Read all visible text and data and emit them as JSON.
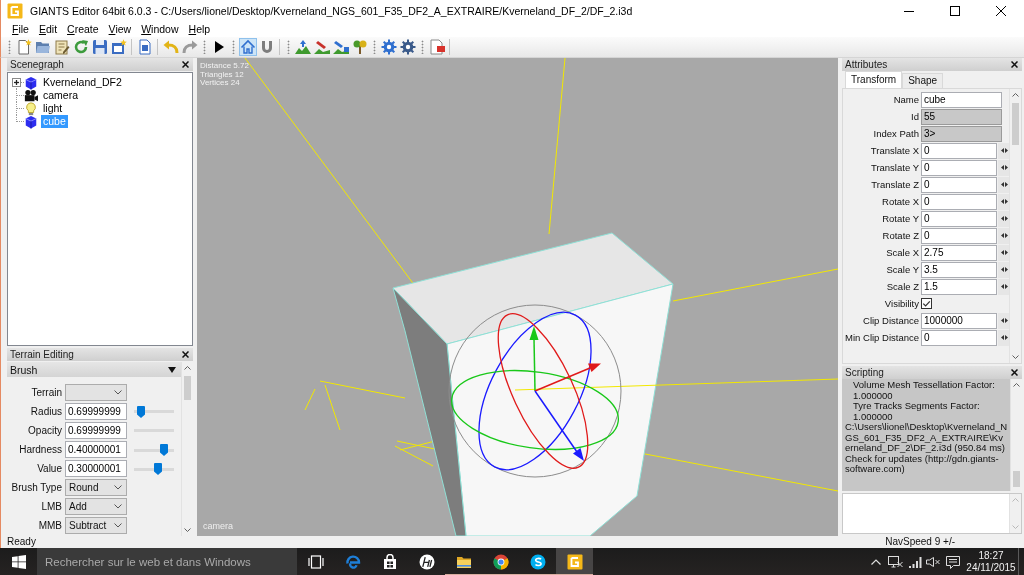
{
  "window": {
    "title": "GIANTS Editor 64bit 6.0.3 - C:/Users/lionel/Desktop/Kverneland_NGS_601_F35_DF2_A_EXTRAIRE/Kverneland_DF_2/DF_2.i3d"
  },
  "menu": [
    "File",
    "Edit",
    "Create",
    "View",
    "Window",
    "Help"
  ],
  "toolbar": [
    {
      "grip": true,
      "separator": false,
      "buttons": [
        {
          "selected": false
        },
        {
          "selected": false
        },
        {
          "selected": false
        },
        {
          "selected": false
        },
        {
          "selected": false
        },
        {
          "selected": false
        }
      ]
    },
    {
      "grip": false,
      "separator": true,
      "buttons": [
        {
          "selected": false
        }
      ]
    },
    {
      "grip": false,
      "separator": true,
      "buttons": [
        {
          "selected": false
        },
        {
          "selected": false
        }
      ]
    },
    {
      "grip": true,
      "separator": false,
      "buttons": [
        {
          "selected": false
        }
      ]
    },
    {
      "grip": true,
      "separator": false,
      "buttons": [
        {
          "selected": true
        },
        {
          "selected": false
        }
      ]
    },
    {
      "grip": true,
      "separator": true,
      "buttons": [
        {
          "selected": false
        },
        {
          "selected": false
        },
        {
          "selected": false
        },
        {
          "selected": false
        }
      ]
    },
    {
      "grip": true,
      "separator": false,
      "buttons": [
        {
          "selected": false
        },
        {
          "selected": false
        }
      ]
    },
    {
      "grip": true,
      "separator": false,
      "buttons": [
        {
          "selected": false
        }
      ]
    }
  ],
  "scenegraph": {
    "title": "Scenegraph",
    "nodes": [
      {
        "label": "Kverneland_DF2",
        "kind": "shape",
        "expandable": true,
        "expanded": false,
        "selected": false
      },
      {
        "label": "camera",
        "kind": "camera",
        "expandable": false,
        "selected": false
      },
      {
        "label": "light",
        "kind": "light",
        "expandable": false,
        "selected": false
      },
      {
        "label": "cube",
        "kind": "shape",
        "expandable": false,
        "selected": true
      }
    ]
  },
  "terrain_editing": {
    "title": "Terrain Editing",
    "section": "Brush",
    "section_expanded": true,
    "fields": [
      {
        "kind": "select",
        "label": "Terrain"
      },
      {
        "kind": "slider",
        "label": "Radius",
        "value": "0.69999999",
        "level": 0.08
      },
      {
        "kind": "track",
        "label": "Opacity",
        "value": "0.69999999"
      },
      {
        "kind": "slider",
        "label": "Hardness",
        "value": "0.40000001",
        "level": 0.82
      },
      {
        "kind": "slider",
        "label": "Value",
        "value": "0.30000001",
        "level": 0.62
      },
      {
        "kind": "select",
        "label": "Brush Type",
        "value": "Round"
      },
      {
        "kind": "select",
        "label": "LMB",
        "value": "Add"
      },
      {
        "kind": "select",
        "label": "MMB",
        "value": "Subtract"
      }
    ]
  },
  "viewport": {
    "stats": [
      "Distance 5.72",
      "Triangles 12",
      "Vertices 24"
    ],
    "camera": "camera"
  },
  "attributes": {
    "title": "Attributes",
    "tabs": [
      {
        "label": "Transform",
        "selected": true
      },
      {
        "label": "Shape",
        "selected": false
      }
    ],
    "fields": [
      {
        "kind": "text",
        "label": "Name",
        "value": "cube"
      },
      {
        "kind": "readonly",
        "label": "Id",
        "value": "55"
      },
      {
        "kind": "readonly",
        "label": "Index Path",
        "value": "3>"
      },
      {
        "kind": "spin",
        "label": "Translate X",
        "value": "0"
      },
      {
        "kind": "spin",
        "label": "Translate Y",
        "value": "0"
      },
      {
        "kind": "spin",
        "label": "Translate Z",
        "value": "0"
      },
      {
        "kind": "spin",
        "label": "Rotate X",
        "value": "0"
      },
      {
        "kind": "spin",
        "label": "Rotate Y",
        "value": "0"
      },
      {
        "kind": "spin",
        "label": "Rotate Z",
        "value": "0"
      },
      {
        "kind": "spin",
        "label": "Scale X",
        "value": "2.75"
      },
      {
        "kind": "spin",
        "label": "Scale Y",
        "value": "3.5"
      },
      {
        "kind": "spin",
        "label": "Scale Z",
        "value": "1.5"
      },
      {
        "kind": "checkbox",
        "label": "Visibility",
        "checked": true
      },
      {
        "kind": "spin",
        "label": "Clip Distance",
        "value": "1000000"
      },
      {
        "kind": "spin",
        "label": "Min Clip Distance",
        "value": "0"
      }
    ]
  },
  "scripting": {
    "title": "Scripting",
    "log": [
      {
        "kind": "setting",
        "text": "Volume Mesh Tessellation Factor: 1.000000"
      },
      {
        "kind": "setting",
        "text": "Tyre Tracks Segments Factor: 1.000000"
      },
      {
        "kind": "message",
        "text": "C:\\Users\\lionel\\Desktop\\Kverneland_NGS_601_F35_DF2_A_EXTRAIRE\\Kverneland_DF_2\\DF_2.i3d (950.84 ms)"
      },
      {
        "kind": "message",
        "text": "Check for updates (http://gdn.giants-software.com)"
      }
    ]
  },
  "status_bar": {
    "message": "Ready",
    "nav_speed": "NavSpeed 9 +/-"
  },
  "taskbar": {
    "search": {
      "placeholder": "Rechercher sur le web et dans Windows"
    },
    "apps": [
      {
        "running": false,
        "selected": false
      },
      {
        "running": false,
        "selected": false
      },
      {
        "running": false,
        "selected": false
      },
      {
        "running": true,
        "selected": false
      },
      {
        "running": true,
        "selected": false
      },
      {
        "running": true,
        "selected": false
      },
      {
        "running": true,
        "selected": true
      }
    ],
    "time": "18:27",
    "date": "24/11/2015"
  }
}
